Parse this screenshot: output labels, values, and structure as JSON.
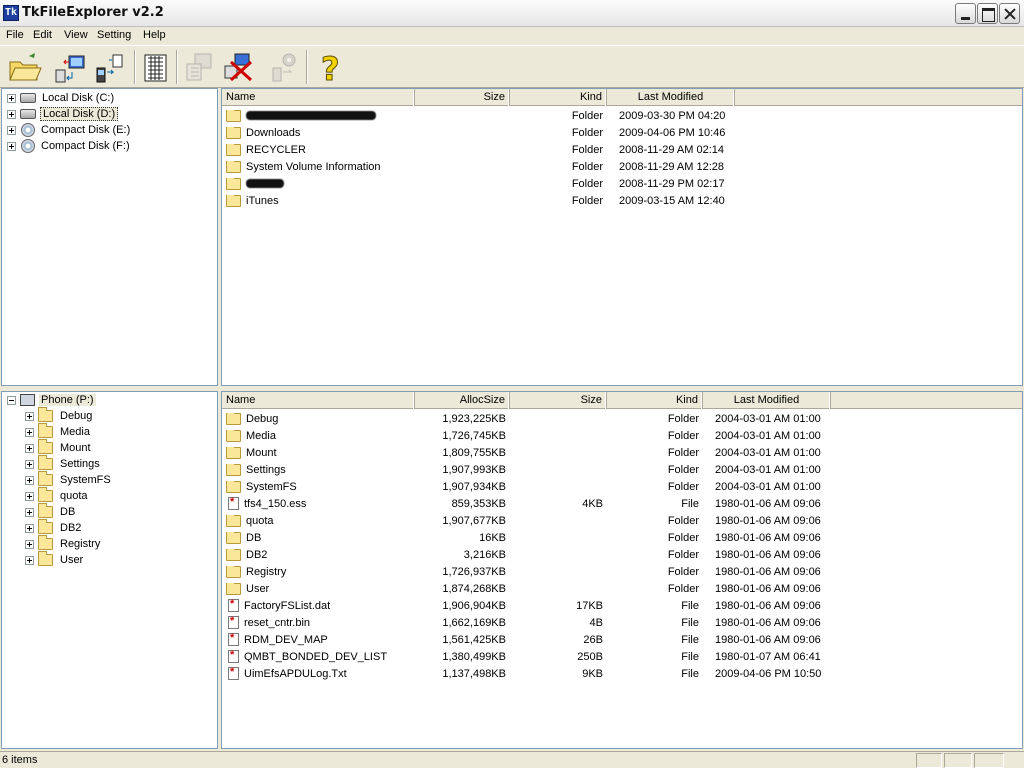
{
  "window": {
    "title": "TkFileExplorer v2.2",
    "icon_text": "Tk"
  },
  "menu": [
    "File",
    "Edit",
    "View",
    "Setting",
    "Help"
  ],
  "toolbar": {
    "buttons": [
      "open-folder-icon",
      "pc-to-phone-icon",
      "phone-to-pc-icon",
      "list-view-icon",
      "copy-disabled-icon",
      "disconnect-icon",
      "settings-disabled-icon",
      "help-icon"
    ]
  },
  "top_tree": {
    "items": [
      {
        "label": "Local Disk (C:)",
        "icon": "drive-icon"
      },
      {
        "label": "Local Disk (D:)",
        "icon": "drive-icon"
      },
      {
        "label": "Compact Disk (E:)",
        "icon": "cd-icon"
      },
      {
        "label": "Compact Disk (F:)",
        "icon": "cd-icon"
      }
    ]
  },
  "top_list": {
    "headers": {
      "name": "Name",
      "size": "Size",
      "kind": "Kind",
      "modified": "Last Modified"
    },
    "rows": [
      {
        "name": "",
        "size": "",
        "kind": "Folder",
        "modified": "2009-03-30 PM 04:20",
        "icon": "folder-icon"
      },
      {
        "name": "Downloads",
        "size": "",
        "kind": "Folder",
        "modified": "2009-04-06 PM 10:46",
        "icon": "folder-icon"
      },
      {
        "name": "RECYCLER",
        "size": "",
        "kind": "Folder",
        "modified": "2008-11-29 AM 02:14",
        "icon": "folder-icon"
      },
      {
        "name": "System Volume Information",
        "size": "",
        "kind": "Folder",
        "modified": "2008-11-29 AM 12:28",
        "icon": "folder-icon"
      },
      {
        "name": "",
        "size": "",
        "kind": "Folder",
        "modified": "2008-11-29 PM 02:17",
        "icon": "folder-icon"
      },
      {
        "name": "iTunes",
        "size": "",
        "kind": "Folder",
        "modified": "2009-03-15 AM 12:40",
        "icon": "folder-icon"
      }
    ]
  },
  "bottom_tree": {
    "root": "Phone (P:)",
    "items": [
      "Debug",
      "Media",
      "Mount",
      "Settings",
      "SystemFS",
      "quota",
      "DB",
      "DB2",
      "Registry",
      "User"
    ]
  },
  "bottom_list": {
    "headers": {
      "name": "Name",
      "alloc": "AllocSize",
      "size": "Size",
      "kind": "Kind",
      "modified": "Last Modified"
    },
    "rows": [
      {
        "name": "Debug",
        "alloc": "1,923,225KB",
        "size": "",
        "kind": "Folder",
        "modified": "2004-03-01 AM 01:00",
        "icon": "folder-icon"
      },
      {
        "name": "Media",
        "alloc": "1,726,745KB",
        "size": "",
        "kind": "Folder",
        "modified": "2004-03-01 AM 01:00",
        "icon": "folder-icon"
      },
      {
        "name": "Mount",
        "alloc": "1,809,755KB",
        "size": "",
        "kind": "Folder",
        "modified": "2004-03-01 AM 01:00",
        "icon": "folder-icon"
      },
      {
        "name": "Settings",
        "alloc": "1,907,993KB",
        "size": "",
        "kind": "Folder",
        "modified": "2004-03-01 AM 01:00",
        "icon": "folder-icon"
      },
      {
        "name": "SystemFS",
        "alloc": "1,907,934KB",
        "size": "",
        "kind": "Folder",
        "modified": "2004-03-01 AM 01:00",
        "icon": "folder-icon"
      },
      {
        "name": "tfs4_150.ess",
        "alloc": "859,353KB",
        "size": "4KB",
        "kind": "File",
        "modified": "1980-01-06 AM 09:06",
        "icon": "file-icon"
      },
      {
        "name": "quota",
        "alloc": "1,907,677KB",
        "size": "",
        "kind": "Folder",
        "modified": "1980-01-06 AM 09:06",
        "icon": "folder-icon"
      },
      {
        "name": "DB",
        "alloc": "16KB",
        "size": "",
        "kind": "Folder",
        "modified": "1980-01-06 AM 09:06",
        "icon": "folder-icon"
      },
      {
        "name": "DB2",
        "alloc": "3,216KB",
        "size": "",
        "kind": "Folder",
        "modified": "1980-01-06 AM 09:06",
        "icon": "folder-icon"
      },
      {
        "name": "Registry",
        "alloc": "1,726,937KB",
        "size": "",
        "kind": "Folder",
        "modified": "1980-01-06 AM 09:06",
        "icon": "folder-icon"
      },
      {
        "name": "User",
        "alloc": "1,874,268KB",
        "size": "",
        "kind": "Folder",
        "modified": "1980-01-06 AM 09:06",
        "icon": "folder-icon"
      },
      {
        "name": "FactoryFSList.dat",
        "alloc": "1,906,904KB",
        "size": "17KB",
        "kind": "File",
        "modified": "1980-01-06 AM 09:06",
        "icon": "file-icon"
      },
      {
        "name": "reset_cntr.bin",
        "alloc": "1,662,169KB",
        "size": "4B",
        "kind": "File",
        "modified": "1980-01-06 AM 09:06",
        "icon": "file-icon"
      },
      {
        "name": "RDM_DEV_MAP",
        "alloc": "1,561,425KB",
        "size": "26B",
        "kind": "File",
        "modified": "1980-01-06 AM 09:06",
        "icon": "file-icon"
      },
      {
        "name": "QMBT_BONDED_DEV_LIST",
        "alloc": "1,380,499KB",
        "size": "250B",
        "kind": "File",
        "modified": "1980-01-07 AM 06:41",
        "icon": "file-icon"
      },
      {
        "name": "UimEfsAPDULog.Txt",
        "alloc": "1,137,498KB",
        "size": "9KB",
        "kind": "File",
        "modified": "2009-04-06 PM 10:50",
        "icon": "file-icon"
      }
    ]
  },
  "status": {
    "text": "6 items"
  }
}
